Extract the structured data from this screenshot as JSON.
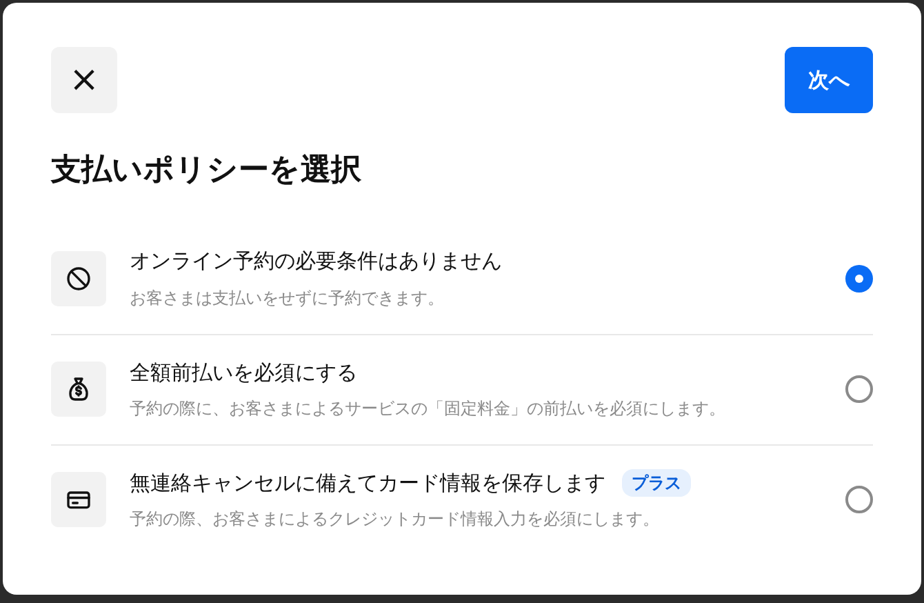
{
  "close_button": {
    "label": "×"
  },
  "next_button": {
    "label": "次へ"
  },
  "title": "支払いポリシーを選択",
  "options": [
    {
      "title": "オンライン予約の必要条件はありません",
      "description": "お客さまは支払いをせずに予約できます。",
      "selected": true
    },
    {
      "title": "全額前払いを必須にする",
      "description": "予約の際に、お客さまによるサービスの「固定料金」の前払いを必須にします。",
      "selected": false
    },
    {
      "title": "無連絡キャンセルに備えてカード情報を保存します",
      "badge": "プラス",
      "description": "予約の際、お客さまによるクレジットカード情報入力を必須にします。",
      "selected": false
    }
  ]
}
